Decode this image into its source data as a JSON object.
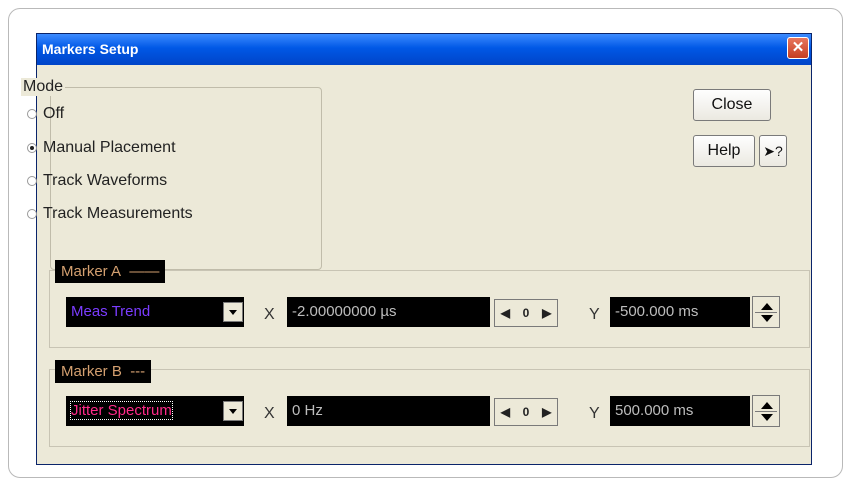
{
  "dialog": {
    "title": "Markers Setup",
    "close_glyph": "✕"
  },
  "mode": {
    "legend": "Mode",
    "options": [
      {
        "label": "Off",
        "checked": false
      },
      {
        "label": "Manual Placement",
        "checked": true
      },
      {
        "label": "Track Waveforms",
        "checked": false
      },
      {
        "label": "Track Measurements",
        "checked": false
      }
    ]
  },
  "buttons": {
    "close": "Close",
    "help": "Help",
    "whats_this": "?"
  },
  "marker_a": {
    "label": "Marker A",
    "line_style": "——",
    "source": "Meas Trend",
    "source_color": "#7b3cff",
    "x_label": "X",
    "x_value": "-2.00000000 µs",
    "stepper_value": "0",
    "y_label": "Y",
    "y_value": "-500.000 ms"
  },
  "marker_b": {
    "label": "Marker B",
    "line_style": "---",
    "source": "Jitter Spectrum",
    "source_color": "#ff2b8a",
    "x_label": "X",
    "x_value": "0 Hz",
    "stepper_value": "0",
    "y_label": "Y",
    "y_value": "500.000 ms"
  }
}
